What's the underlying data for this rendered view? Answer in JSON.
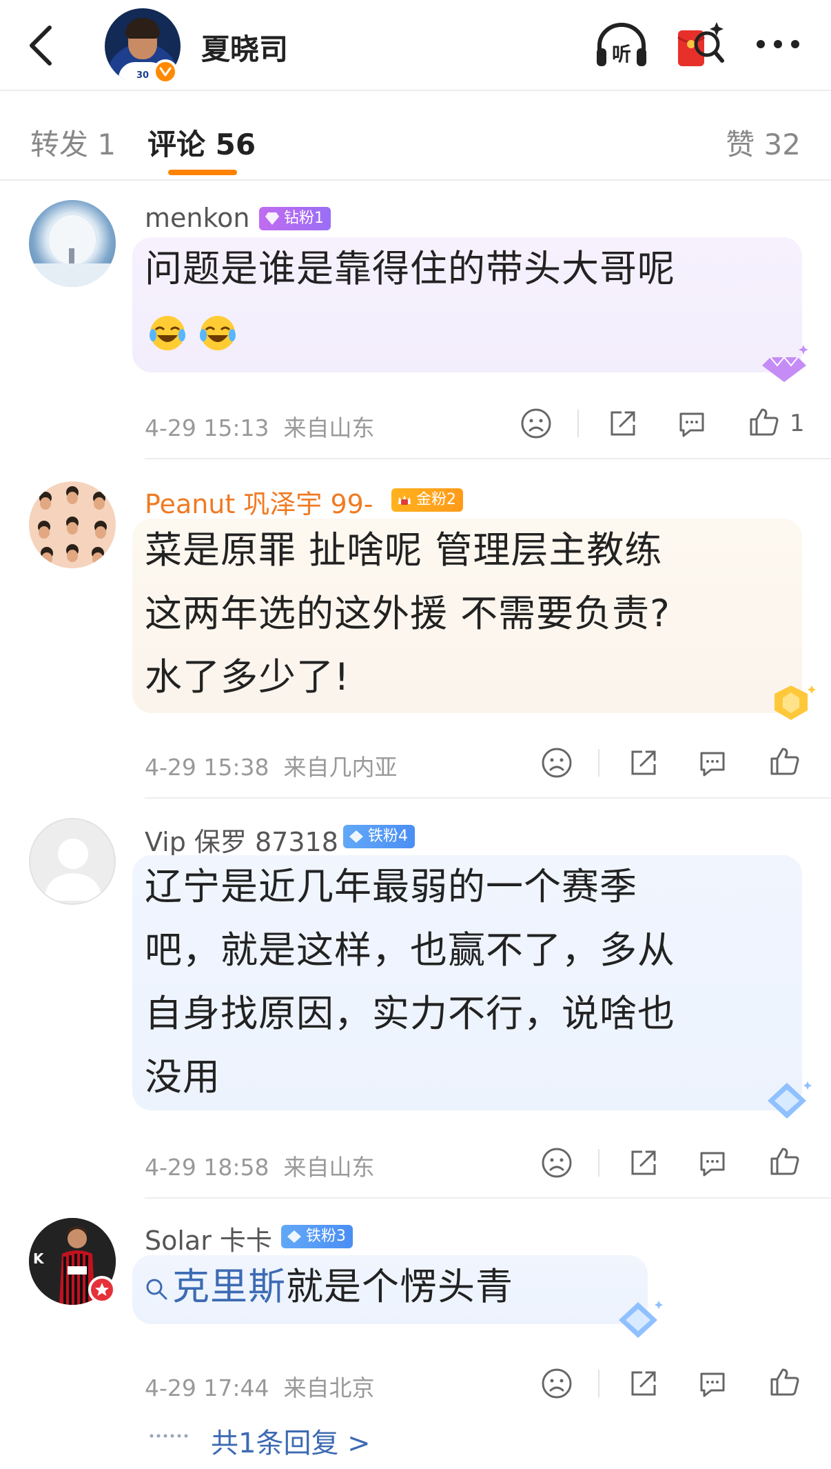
{
  "header": {
    "user_name": "夏晓司",
    "listen_label": "听"
  },
  "tabs": {
    "forward": "转发 1",
    "comments": "评论 56",
    "likes": "赞 32"
  },
  "comments": [
    {
      "user": "menkon",
      "badge": "钻粉1",
      "text_lines": [
        "问题是谁是靠得住的带头大哥呢"
      ],
      "emoji": [
        "laugh-cry-emoji",
        "laugh-cry-emoji"
      ],
      "timestamp": "4-29 15:13",
      "location": "来自山东",
      "like_count": "1"
    },
    {
      "user": "Peanut 巩泽宇 99-",
      "badge": "金粉2",
      "text_lines": [
        "菜是原罪 扯啥呢 管理层主教练",
        "这两年选的这外援 不需要负责?",
        "水了多少了!"
      ],
      "timestamp": "4-29 15:38",
      "location": "来自几内亚"
    },
    {
      "user": "Vip 保罗 87318",
      "badge": "铁粉4",
      "text_lines": [
        "辽宁是近几年最弱的一个赛季",
        "吧，就是这样，也赢不了，多从",
        "自身找原因，实力不行，说啥也",
        "没用"
      ],
      "timestamp": "4-29 18:58",
      "location": "来自山东"
    },
    {
      "user": "Solar 卡卡",
      "badge": "铁粉3",
      "topic_link": "克里斯",
      "text_rest": "就是个愣头青",
      "timestamp": "4-29 17:44",
      "location": "来自北京",
      "reply_summary": "共1条回复 >"
    }
  ],
  "colors": {
    "accent": "#ff8200",
    "link": "#3d6bb3",
    "badge_diamond": "#b06cf2",
    "badge_gold": "#ffa61c",
    "badge_iron": "#5599f5"
  }
}
